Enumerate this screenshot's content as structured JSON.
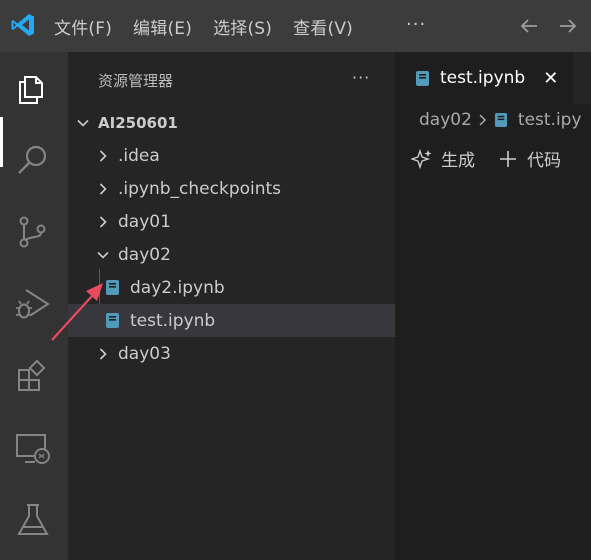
{
  "menu": {
    "items": [
      "文件(F)",
      "编辑(E)",
      "选择(S)",
      "查看(V)"
    ],
    "more": "···"
  },
  "activity_bar": {
    "items": [
      "explorer-icon",
      "search-icon",
      "source-control-icon",
      "run-debug-icon",
      "extensions-icon",
      "remote-explorer-icon",
      "testing-icon"
    ],
    "active": "explorer-icon"
  },
  "sidebar": {
    "title": "资源管理器",
    "more": "···",
    "root": "AI250601",
    "tree": [
      {
        "label": ".idea",
        "type": "folder",
        "expanded": false
      },
      {
        "label": ".ipynb_checkpoints",
        "type": "folder",
        "expanded": false
      },
      {
        "label": "day01",
        "type": "folder",
        "expanded": false
      },
      {
        "label": "day02",
        "type": "folder",
        "expanded": true
      },
      {
        "label": "day2.ipynb",
        "type": "notebook"
      },
      {
        "label": "test.ipynb",
        "type": "notebook",
        "selected": true
      },
      {
        "label": "day03",
        "type": "folder",
        "expanded": false
      }
    ]
  },
  "editor": {
    "tab": {
      "label": "test.ipynb",
      "close": "✕"
    },
    "breadcrumb": [
      "day02",
      "test.ipy"
    ],
    "toolbar": {
      "generate": "生成",
      "add_code": "代码"
    }
  },
  "colors": {
    "accent": "#0078d4",
    "notebook_icon": "#519aba",
    "annotation_arrow": "#e84a5f"
  }
}
